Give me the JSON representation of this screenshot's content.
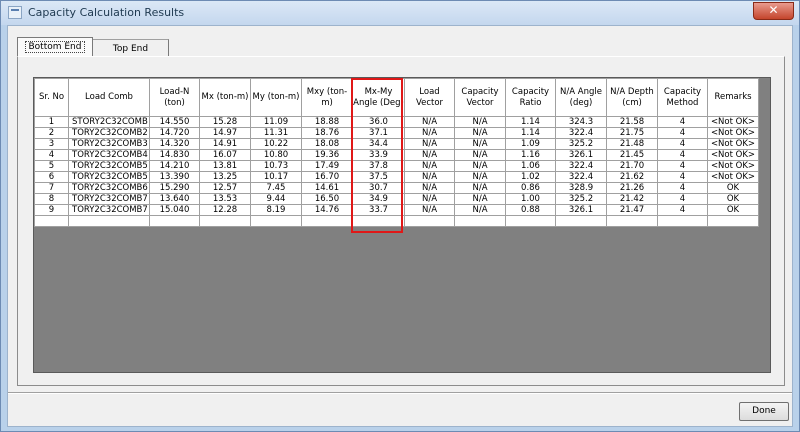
{
  "window": {
    "title": "Capacity Calculation Results",
    "close_glyph": "✕"
  },
  "tabs": [
    {
      "label": "Bottom End"
    },
    {
      "label": "Top End"
    }
  ],
  "table": {
    "headers": [
      "Sr. No",
      "Load Comb",
      "Load-N (ton)",
      "Mx (ton-m)",
      "My (ton-m)",
      "Mxy (ton-m)",
      "Mx-My Angle (Deg)",
      "Load Vector",
      "Capacity Vector",
      "Capacity Ratio",
      "N/A Angle (deg)",
      "N/A Depth (cm)",
      "Capacity Method",
      "Remarks"
    ],
    "rows": [
      [
        "1",
        "STORY2C32COMB",
        "14.550",
        "15.28",
        "11.09",
        "18.88",
        "36.0",
        "N/A",
        "N/A",
        "1.14",
        "324.3",
        "21.58",
        "4",
        "<Not OK>"
      ],
      [
        "2",
        "TORY2C32COMB2",
        "14.720",
        "14.97",
        "11.31",
        "18.76",
        "37.1",
        "N/A",
        "N/A",
        "1.14",
        "322.4",
        "21.75",
        "4",
        "<Not OK>"
      ],
      [
        "3",
        "TORY2C32COMB3",
        "14.320",
        "14.91",
        "10.22",
        "18.08",
        "34.4",
        "N/A",
        "N/A",
        "1.09",
        "325.2",
        "21.48",
        "4",
        "<Not OK>"
      ],
      [
        "4",
        "TORY2C32COMB4",
        "14.830",
        "16.07",
        "10.80",
        "19.36",
        "33.9",
        "N/A",
        "N/A",
        "1.16",
        "326.1",
        "21.45",
        "4",
        "<Not OK>"
      ],
      [
        "5",
        "TORY2C32COMB5",
        "14.210",
        "13.81",
        "10.73",
        "17.49",
        "37.8",
        "N/A",
        "N/A",
        "1.06",
        "322.4",
        "21.70",
        "4",
        "<Not OK>"
      ],
      [
        "6",
        "TORY2C32COMB5",
        "13.390",
        "13.25",
        "10.17",
        "16.70",
        "37.5",
        "N/A",
        "N/A",
        "1.02",
        "322.4",
        "21.62",
        "4",
        "<Not OK>"
      ],
      [
        "7",
        "TORY2C32COMB6",
        "15.290",
        "12.57",
        "7.45",
        "14.61",
        "30.7",
        "N/A",
        "N/A",
        "0.86",
        "328.9",
        "21.26",
        "4",
        "OK"
      ],
      [
        "8",
        "TORY2C32COMB7",
        "13.640",
        "13.53",
        "9.44",
        "16.50",
        "34.9",
        "N/A",
        "N/A",
        "1.00",
        "325.2",
        "21.42",
        "4",
        "OK"
      ],
      [
        "9",
        "TORY2C32COMB7",
        "15.040",
        "12.28",
        "8.19",
        "14.76",
        "33.7",
        "N/A",
        "N/A",
        "0.88",
        "326.1",
        "21.47",
        "4",
        "OK"
      ]
    ]
  },
  "buttons": {
    "done": "Done"
  }
}
